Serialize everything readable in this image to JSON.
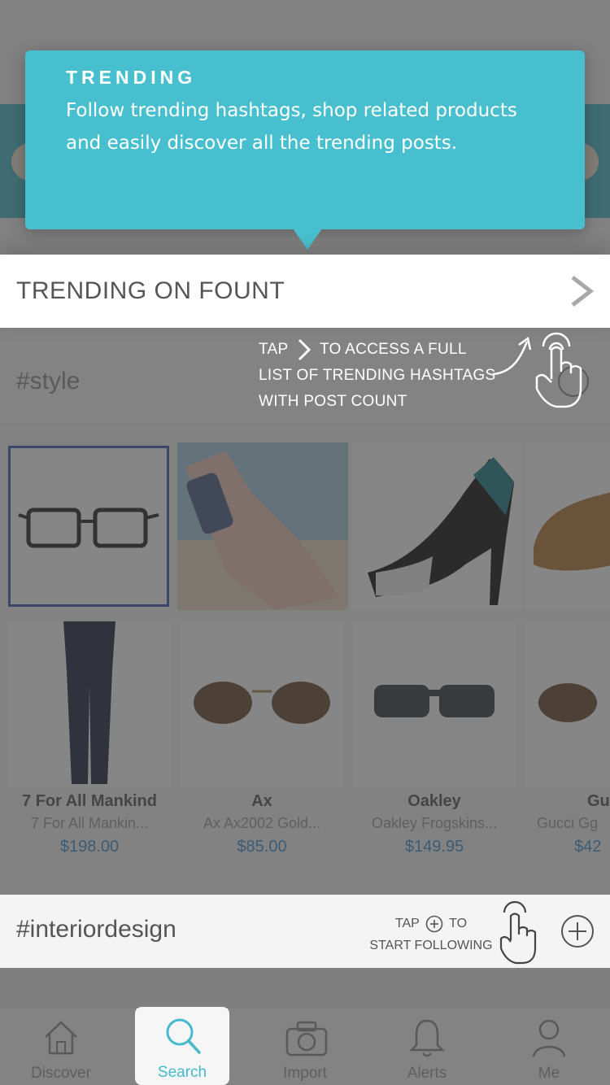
{
  "tooltip": {
    "title": "TRENDING",
    "body": "Follow trending hashtags, shop related products and easily discover all the trending posts."
  },
  "trending_header": {
    "title": "TRENDING ON FOUNT"
  },
  "access_hint": {
    "line1_prefix": "TAP",
    "line1_suffix": "TO ACCESS A FULL",
    "line2": "LIST OF TRENDING HASHTAGS",
    "line3": "WITH POST COUNT"
  },
  "hashtag_style": {
    "tag": "#style"
  },
  "products": [
    {
      "brand": "7 For All Mankind",
      "name": "7 For All Mankin...",
      "price": "$198.00"
    },
    {
      "brand": "Ax",
      "name": "Ax Ax2002 Gold...",
      "price": "$85.00"
    },
    {
      "brand": "Oakley",
      "name": "Oakley Frogskins...",
      "price": "$149.95"
    },
    {
      "brand": "Gu",
      "name": "Gucci Gg",
      "price": "$42"
    }
  ],
  "follow_row": {
    "tag": "#interiordesign",
    "hint_prefix": "TAP",
    "hint_suffix": "TO",
    "hint_line2": "START FOLLOWING"
  },
  "tabbar": {
    "tabs": [
      {
        "label": "Discover",
        "icon": "home-icon"
      },
      {
        "label": "Search",
        "icon": "search-icon",
        "active": true
      },
      {
        "label": "Import",
        "icon": "camera-icon"
      },
      {
        "label": "Alerts",
        "icon": "bell-icon"
      },
      {
        "label": "Me",
        "icon": "person-icon"
      }
    ]
  },
  "colors": {
    "accent": "#48bfcf",
    "dim_overlay": "rgba(60,60,60,0.62)",
    "price": "#3e8fd0"
  }
}
